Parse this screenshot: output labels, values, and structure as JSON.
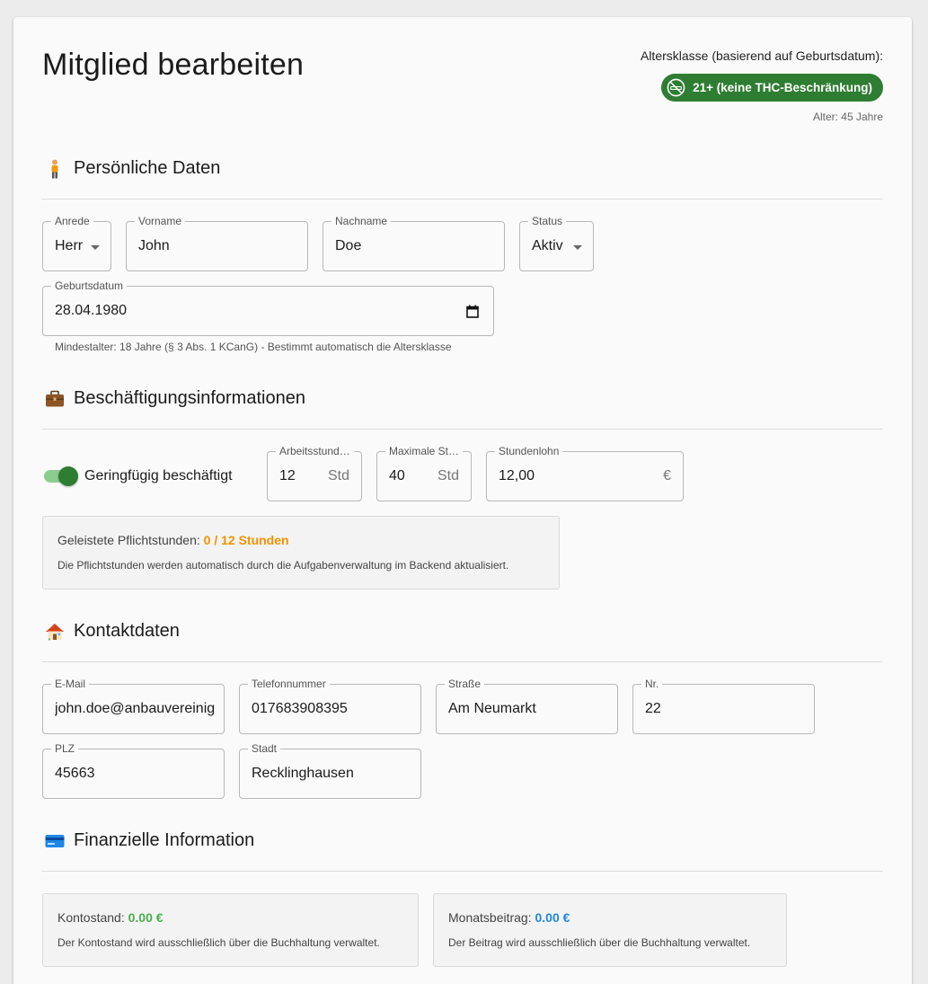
{
  "header": {
    "title": "Mitglied bearbeiten",
    "age_class_label": "Altersklasse (basierend auf Geburtsdatum):",
    "age_class_chip": "21+ (keine THC-Beschränkung)",
    "age_text": "Alter: 45 Jahre"
  },
  "personal": {
    "section_title": "Persönliche Daten",
    "anrede": {
      "label": "Anrede",
      "value": "Herr"
    },
    "vorname": {
      "label": "Vorname",
      "value": "John"
    },
    "nachname": {
      "label": "Nachname",
      "value": "Doe"
    },
    "status": {
      "label": "Status",
      "value": "Aktiv"
    },
    "geburtsdatum": {
      "label": "Geburtsdatum",
      "value": "28.04.1980"
    },
    "helper": "Mindestalter: 18 Jahre (§ 3 Abs. 1 KCanG) - Bestimmt automatisch die Altersklasse"
  },
  "employment": {
    "section_title": "Beschäftigungsinformationen",
    "toggle_label": "Geringfügig beschäftigt",
    "toggle_on": true,
    "arbeitsstunden": {
      "label": "Arbeitsstund…",
      "value": "12",
      "suffix": "Std"
    },
    "max_stunden": {
      "label": "Maximale St…",
      "value": "40",
      "suffix": "Std"
    },
    "stundenlohn": {
      "label": "Stundenlohn",
      "value": "12,00",
      "suffix": "€"
    },
    "pflicht_label": "Geleistete Pflichtstunden:",
    "pflicht_value": "0 / 12 Stunden",
    "pflicht_note": "Die Pflichtstunden werden automatisch durch die Aufgabenverwaltung im Backend aktualisiert."
  },
  "contact": {
    "section_title": "Kontaktdaten",
    "email": {
      "label": "E-Mail",
      "value": "john.doe@anbauvereinigung.de"
    },
    "telefon": {
      "label": "Telefonnummer",
      "value": "017683908395"
    },
    "strasse": {
      "label": "Straße",
      "value": "Am Neumarkt"
    },
    "nr": {
      "label": "Nr.",
      "value": "22"
    },
    "plz": {
      "label": "PLZ",
      "value": "45663"
    },
    "stadt": {
      "label": "Stadt",
      "value": "Recklinghausen"
    }
  },
  "finance": {
    "section_title": "Finanzielle Information",
    "kontostand_label": "Kontostand:",
    "kontostand_value": "0.00 €",
    "kontostand_note": "Der Kontostand wird ausschließlich über die Buchhaltung verwaltet.",
    "beitrag_label": "Monatsbeitrag:",
    "beitrag_value": "0.00 €",
    "beitrag_note": "Der Beitrag wird ausschließlich über die Buchhaltung verwaltet."
  },
  "colors": {
    "accent_green": "#2e7d32",
    "warning_orange": "#f39200",
    "balance_green": "#4caf50",
    "fee_blue": "#1e88e5"
  },
  "icons": {
    "age_chip": "no-smoking-21-icon",
    "personal": "person-icon",
    "employment": "briefcase-icon",
    "contact": "house-icon",
    "finance": "credit-card-icon",
    "date": "calendar-icon"
  }
}
